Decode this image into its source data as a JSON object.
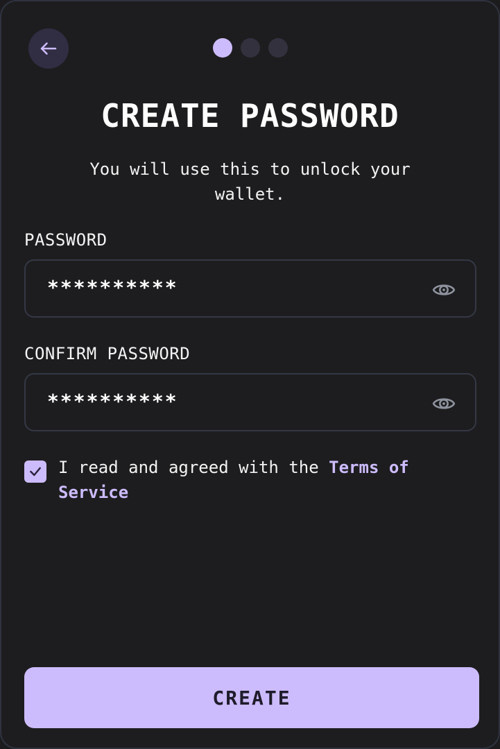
{
  "header": {
    "title": "CREATE PASSWORD",
    "subtitle": "You will use this to unlock your wallet.",
    "step_current": 1,
    "step_total": 3
  },
  "form": {
    "password_label": "PASSWORD",
    "password_value": "**********",
    "confirm_label": "CONFIRM PASSWORD",
    "confirm_value": "**********"
  },
  "agreement": {
    "checked": true,
    "text": "I read and agreed with the ",
    "link_text": "Terms of Service"
  },
  "actions": {
    "create_label": "CREATE"
  },
  "icons": {
    "back": "arrow-left-icon",
    "reveal": "eye-icon",
    "check": "check-icon"
  },
  "colors": {
    "accent": "#cdbcfd",
    "background": "#1d1d1f",
    "back_button_bg": "#312d43",
    "inactive_dot": "#34313f",
    "field_border": "#343845"
  }
}
